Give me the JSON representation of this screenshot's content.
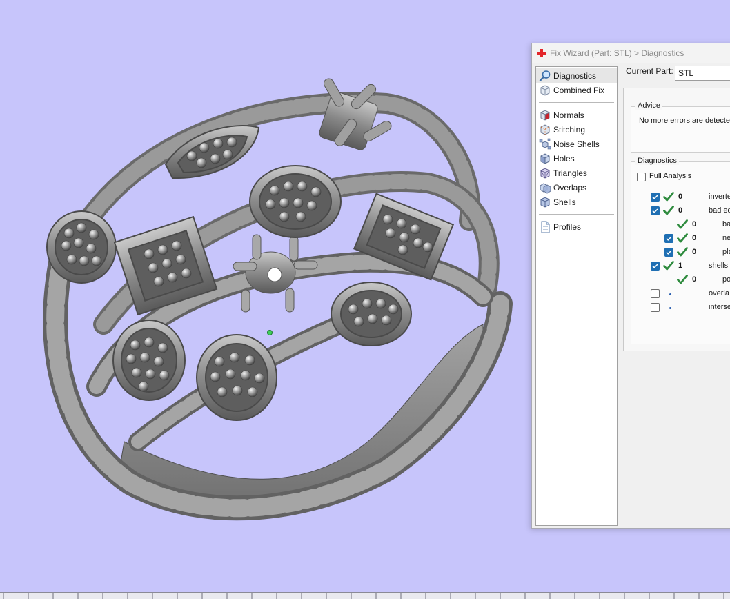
{
  "dialog": {
    "title": "Fix Wizard (Part: STL) > Diagnostics",
    "current_part_label": "Current Part:",
    "current_part_value": "STL"
  },
  "nav": {
    "items": [
      {
        "label": "Diagnostics",
        "icon": "magnifier-icon"
      },
      {
        "label": "Combined Fix",
        "icon": "cube-icon"
      },
      {
        "label": "Normals",
        "icon": "normals-cube-icon"
      },
      {
        "label": "Stitching",
        "icon": "stitching-cube-icon"
      },
      {
        "label": "Noise Shells",
        "icon": "noise-shells-icon"
      },
      {
        "label": "Holes",
        "icon": "holes-cube-icon"
      },
      {
        "label": "Triangles",
        "icon": "triangles-cube-icon"
      },
      {
        "label": "Overlaps",
        "icon": "overlaps-cube-icon"
      },
      {
        "label": "Shells",
        "icon": "shells-cube-icon"
      },
      {
        "label": "Profiles",
        "icon": "document-icon"
      }
    ]
  },
  "advice": {
    "title": "Advice",
    "text": "No more errors are detected"
  },
  "diagnostics": {
    "title": "Diagnostics",
    "full_analysis_label": "Full Analysis",
    "full_analysis_checked": false,
    "rows": [
      {
        "checkbox": "on",
        "status": "ok",
        "count": "0",
        "label": "inverte"
      },
      {
        "checkbox": "on",
        "status": "ok",
        "count": "0",
        "label": "bad ed"
      },
      {
        "checkbox": "none",
        "status": "ok",
        "count": "0",
        "label": "ba"
      },
      {
        "checkbox": "on",
        "status": "ok",
        "count": "0",
        "label": "ne"
      },
      {
        "checkbox": "on",
        "status": "ok",
        "count": "0",
        "label": "pla"
      },
      {
        "checkbox": "on",
        "status": "ok",
        "count": "1",
        "label": "shells c"
      },
      {
        "checkbox": "none",
        "status": "ok",
        "count": "0",
        "label": "po"
      },
      {
        "checkbox": "off",
        "status": "pending",
        "count": "",
        "label": "overla"
      },
      {
        "checkbox": "off",
        "status": "pending",
        "count": "",
        "label": "interse"
      }
    ]
  },
  "colors": {
    "viewport_background": "#c7c5fb",
    "model_gray": "#8c8c8c",
    "check_blue": "#1f6fb3",
    "ok_green": "#2e8b3e",
    "title_icon_red": "#e3262b"
  }
}
